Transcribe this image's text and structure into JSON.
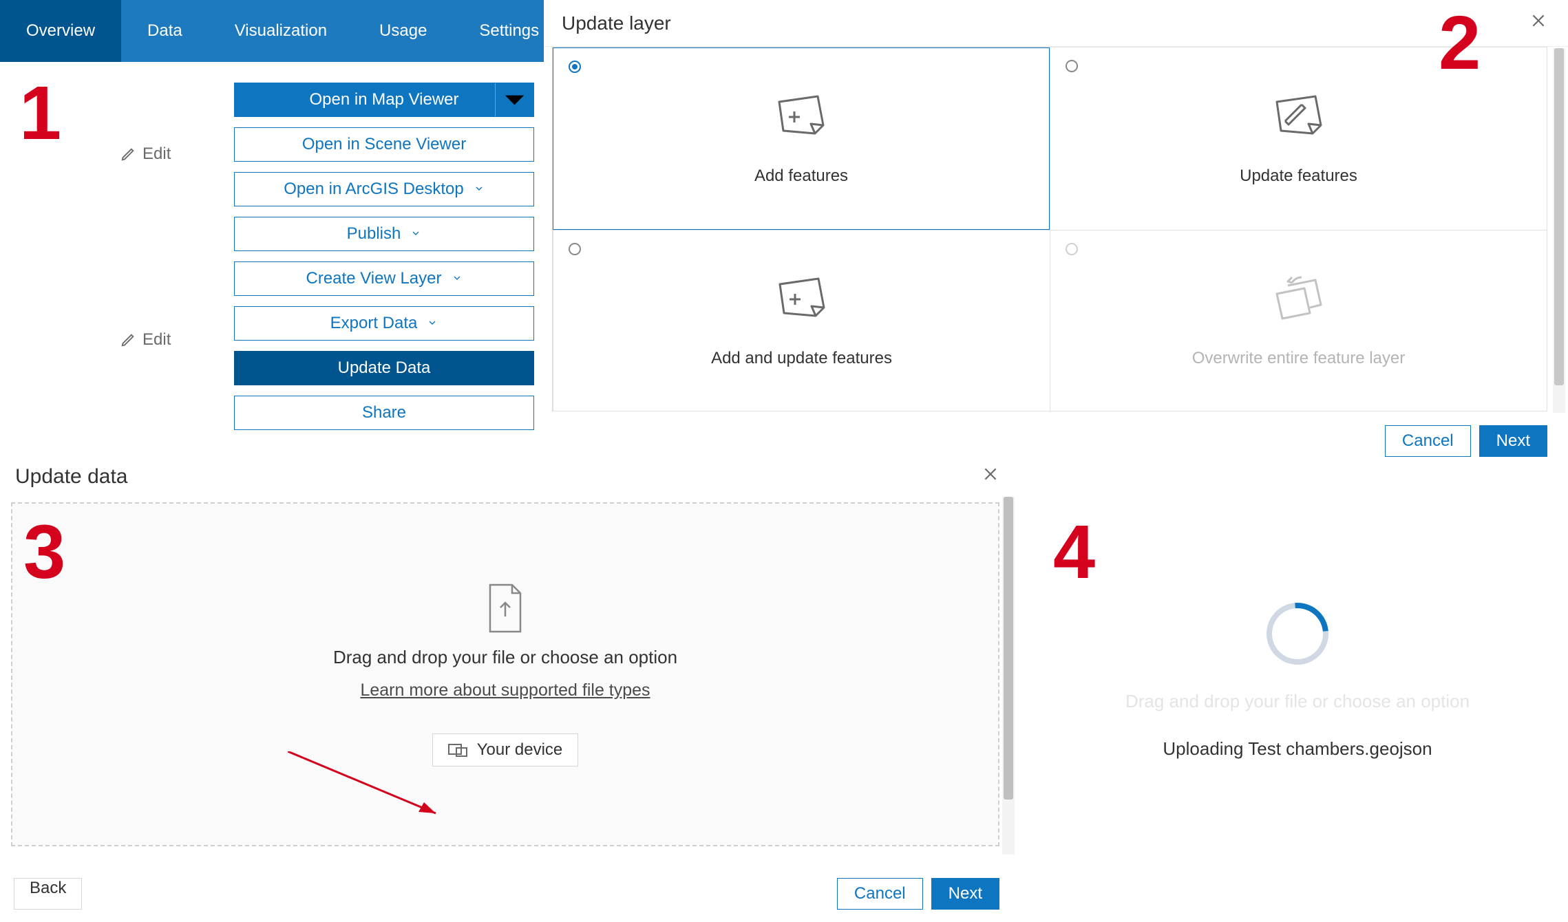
{
  "tabs": {
    "overview": "Overview",
    "data": "Data",
    "visualization": "Visualization",
    "usage": "Usage",
    "settings": "Settings"
  },
  "edit_label": "Edit",
  "actions": {
    "open_map": "Open in Map Viewer",
    "open_scene": "Open in Scene Viewer",
    "open_desktop": "Open in ArcGIS Desktop",
    "publish": "Publish",
    "create_view": "Create View Layer",
    "export": "Export Data",
    "update": "Update Data",
    "share": "Share"
  },
  "update_layer": {
    "title": "Update layer",
    "options": {
      "add": "Add features",
      "update": "Update features",
      "add_update": "Add and update features",
      "overwrite": "Overwrite entire feature layer"
    },
    "cancel": "Cancel",
    "next": "Next"
  },
  "update_data": {
    "title": "Update data",
    "drop_prompt": "Drag and drop your file or choose an option",
    "learn_more": "Learn more about supported file types",
    "your_device": "Your device",
    "back": "Back",
    "cancel": "Cancel",
    "next": "Next"
  },
  "uploading": {
    "ghost": "Drag and drop your file or choose an option",
    "status": "Uploading Test chambers.geojson"
  },
  "annotations": {
    "n1": "1",
    "n2": "2",
    "n3": "3",
    "n4": "4"
  }
}
